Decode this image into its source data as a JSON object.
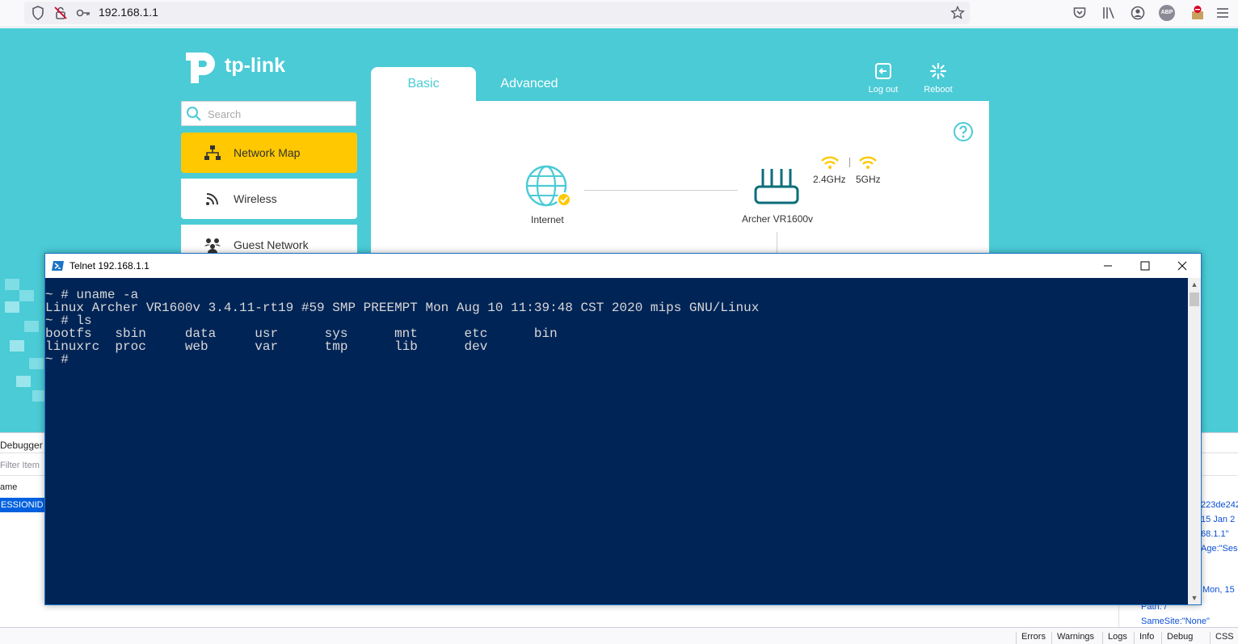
{
  "browser": {
    "url": "192.168.1.1",
    "extension_badge": "ABP"
  },
  "router": {
    "logo_text": "tp-link",
    "tabs": [
      {
        "label": "Basic",
        "active": true
      },
      {
        "label": "Advanced",
        "active": false
      }
    ],
    "actions": {
      "logout_label": "Log out",
      "reboot_label": "Reboot"
    },
    "search": {
      "placeholder": "Search",
      "value": ""
    },
    "menu": [
      {
        "label": "Network Map",
        "icon": "network-map-icon",
        "active": true
      },
      {
        "label": "Wireless",
        "icon": "wireless-icon",
        "active": false
      },
      {
        "label": "Guest Network",
        "icon": "guest-network-icon",
        "active": false
      }
    ],
    "map": {
      "internet_label": "Internet",
      "router_label": "Archer VR1600v",
      "band_24": "2.4GHz",
      "band_5": "5GHz"
    },
    "colors": {
      "brand": "#4acbd6",
      "active_menu": "#ffc800",
      "router_icon": "#0b6e7a"
    }
  },
  "devtools": {
    "tab_label": "Debugger",
    "filter_placeholder": "Filter Item",
    "column_name": "ame",
    "selected_row": "ESSIONID",
    "detail_lines": [
      "223de242",
      "15 Jan 2",
      "68.1.1\"",
      "Age:\"Sess"
    ],
    "detail_lines_2": [
      "Mon, 15",
      "Path: /",
      "SameSite:\"None\""
    ],
    "console_filters": [
      "Errors",
      "Warnings",
      "Logs",
      "Info",
      "Debug",
      "CSS"
    ]
  },
  "telnet": {
    "title": "Telnet 192.168.1.1",
    "lines": [
      "~ # uname -a",
      "Linux Archer VR1600v 3.4.11-rt19 #59 SMP PREEMPT Mon Aug 10 11:39:48 CST 2020 mips GNU/Linux",
      "~ # ls",
      "bootfs   sbin     data     usr      sys      mnt      etc      bin",
      "linuxrc  proc     web      var      tmp      lib      dev",
      "~ #"
    ],
    "colors": {
      "background": "#012456",
      "text": "#d8d8d8"
    }
  }
}
